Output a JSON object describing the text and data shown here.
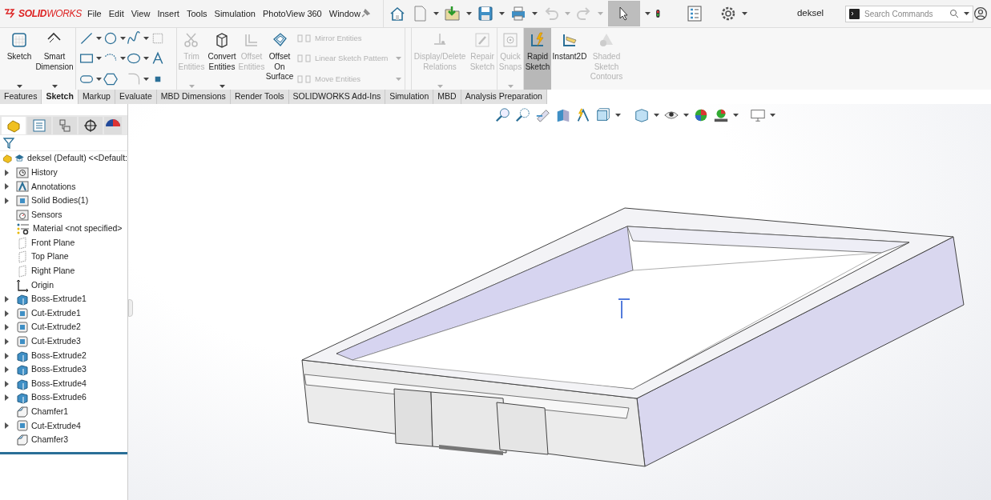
{
  "title_bar": {
    "logo": "**SOLID**WORKS",
    "menu": [
      "File",
      "Edit",
      "View",
      "Insert",
      "Tools",
      "Simulation",
      "PhotoView 360",
      "Window"
    ],
    "select_active": true,
    "undo_disabled": true,
    "redo_disabled": true,
    "document": "deksel",
    "search": {
      "placeholder": "Search Commands"
    }
  },
  "ribbon": {
    "left_buttons": [
      {
        "label": "Sketch",
        "has_menu": true,
        "disabled": false
      },
      {
        "label": "Smart Dimension",
        "has_menu": true,
        "disabled": false
      }
    ],
    "edit_buttons": [
      {
        "label": "Trim Entities",
        "has_menu": true,
        "disabled": true
      },
      {
        "label": "Convert Entities",
        "has_menu": true,
        "disabled": false
      },
      {
        "label": "Offset Entities",
        "has_menu": false,
        "disabled": true
      },
      {
        "label": "Offset On Surface",
        "has_menu": false,
        "disabled": false
      }
    ],
    "pattern_list": [
      {
        "label": "Mirror Entities",
        "disabled": true
      },
      {
        "label": "Linear Sketch Pattern",
        "disabled": true
      },
      {
        "label": "Move Entities",
        "disabled": true
      }
    ],
    "right_buttons": [
      {
        "label": "Display/Delete Relations",
        "has_menu": true,
        "disabled": true,
        "active": false
      },
      {
        "label": "Repair Sketch",
        "has_menu": false,
        "disabled": true,
        "active": false
      },
      {
        "label": "Quick Snaps",
        "has_menu": true,
        "disabled": true,
        "active": false
      },
      {
        "label": "Rapid Sketch",
        "has_menu": false,
        "disabled": false,
        "active": true
      },
      {
        "label": "Instant2D",
        "has_menu": false,
        "disabled": false,
        "active": false
      },
      {
        "label": "Shaded Sketch Contours",
        "has_menu": false,
        "disabled": true,
        "active": false
      }
    ]
  },
  "tabs": [
    {
      "label": "Features",
      "selected": false
    },
    {
      "label": "Sketch",
      "selected": true
    },
    {
      "label": "Markup",
      "selected": false
    },
    {
      "label": "Evaluate",
      "selected": false
    },
    {
      "label": "MBD Dimensions",
      "selected": false
    },
    {
      "label": "Render Tools",
      "selected": false
    },
    {
      "label": "SOLIDWORKS Add-Ins",
      "selected": false
    },
    {
      "label": "Simulation",
      "selected": false
    },
    {
      "label": "MBD",
      "selected": false
    },
    {
      "label": "Analysis Preparation",
      "selected": false
    }
  ],
  "tree": {
    "label": "deksel (Default) <<Default:",
    "children": [
      {
        "label": "History",
        "kind": "history",
        "expandable": true
      },
      {
        "label": "Annotations",
        "kind": "annotations",
        "expandable": true
      },
      {
        "label": "Solid Bodies(1)",
        "kind": "bodies",
        "expandable": true
      },
      {
        "label": "Sensors",
        "kind": "sensors",
        "expandable": false
      },
      {
        "label": "Material <not specified>",
        "kind": "material",
        "expandable": false
      },
      {
        "label": "Front Plane",
        "kind": "plane",
        "expandable": false
      },
      {
        "label": "Top Plane",
        "kind": "plane",
        "expandable": false
      },
      {
        "label": "Right Plane",
        "kind": "plane",
        "expandable": false
      },
      {
        "label": "Origin",
        "kind": "origin",
        "expandable": false
      },
      {
        "label": "Boss-Extrude1",
        "kind": "boss",
        "expandable": true
      },
      {
        "label": "Cut-Extrude1",
        "kind": "cut",
        "expandable": true
      },
      {
        "label": "Cut-Extrude2",
        "kind": "cut",
        "expandable": true
      },
      {
        "label": "Cut-Extrude3",
        "kind": "cut",
        "expandable": true
      },
      {
        "label": "Boss-Extrude2",
        "kind": "boss",
        "expandable": true
      },
      {
        "label": "Boss-Extrude3",
        "kind": "boss",
        "expandable": true
      },
      {
        "label": "Boss-Extrude4",
        "kind": "boss",
        "expandable": true
      },
      {
        "label": "Boss-Extrude6",
        "kind": "boss",
        "expandable": true
      },
      {
        "label": "Chamfer1",
        "kind": "chamfer",
        "expandable": false
      },
      {
        "label": "Cut-Extrude4",
        "kind": "cut",
        "expandable": true
      },
      {
        "label": "Chamfer3",
        "kind": "chamfer",
        "expandable": false
      }
    ]
  }
}
